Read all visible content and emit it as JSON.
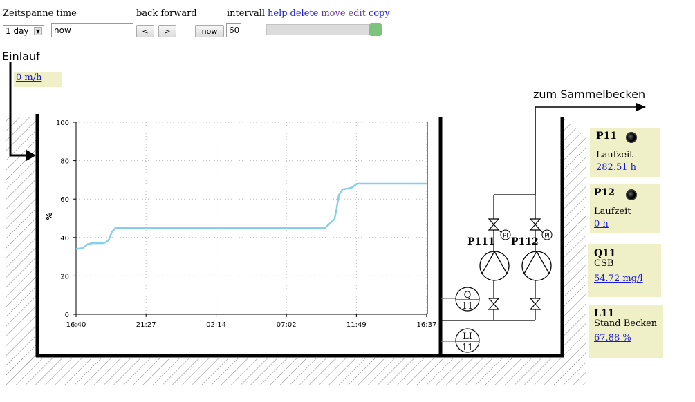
{
  "toolbar": {
    "timespan_label": "Zeitspanne time",
    "navigate_label": "back forward",
    "interval_label": "intervall",
    "timespan_value": "1 day",
    "time_value": "now",
    "back_label": "<",
    "forward_label": ">",
    "now_label": "now",
    "interval_value": "60",
    "links": {
      "help": "help",
      "delete": "delete",
      "move": "move",
      "edit": "edit",
      "copy": "copy"
    }
  },
  "diagram": {
    "inlet_label": "Einlauf",
    "inlet_flow": "0 m/h",
    "outlet_label": "zum Sammelbecken",
    "pump1_label": "P111",
    "pump2_label": "P112",
    "pi_label": "PI",
    "q_sensor_tag": "Q",
    "q_sensor_num": "11",
    "li_sensor_tag": "LI",
    "li_sensor_num": "11"
  },
  "panels": {
    "p11": {
      "title": "P11",
      "label": "Laufzeit",
      "value": "282.51 h"
    },
    "p12": {
      "title": "P12",
      "label": "Laufzeit",
      "value": "0 h"
    },
    "q11": {
      "title": "Q11",
      "label": "CSB",
      "value": "54.72 mg/l"
    },
    "l11": {
      "title": "L11",
      "label": "Stand Becken",
      "value": "67.88 %"
    }
  },
  "colors": {
    "series": "#87ceeb",
    "panel_bg": "#efefc8",
    "link": "#1a1ad6"
  },
  "chart_data": {
    "type": "line",
    "ylabel": "%",
    "ylim": [
      0,
      100
    ],
    "yticks": [
      0,
      20,
      40,
      60,
      80,
      100
    ],
    "xlim": [
      0,
      24
    ],
    "xticks": [
      {
        "x": 0,
        "label": "16:40"
      },
      {
        "x": 4.78,
        "label": "21:27"
      },
      {
        "x": 9.57,
        "label": "02:14"
      },
      {
        "x": 14.37,
        "label": "07:02"
      },
      {
        "x": 19.15,
        "label": "11:49"
      },
      {
        "x": 23.95,
        "label": "16:37"
      }
    ],
    "grid": true,
    "series": [
      {
        "x": [
          0,
          0.45,
          0.8,
          1.1,
          1.6,
          1.8,
          2.05,
          2.25,
          2.45,
          2.7,
          3.0,
          4.5,
          8,
          12,
          15,
          16.5,
          17.0,
          17.3,
          17.65,
          17.8,
          17.95,
          18.2,
          18.6,
          18.85,
          19.2,
          20,
          22,
          24
        ],
        "y": [
          34,
          34.5,
          36.5,
          37,
          37,
          37,
          37.5,
          39,
          43,
          45,
          45,
          45,
          45,
          45,
          45,
          45,
          45,
          47,
          49.5,
          55,
          62,
          65,
          65.5,
          66,
          68,
          68,
          68,
          68
        ]
      }
    ]
  }
}
